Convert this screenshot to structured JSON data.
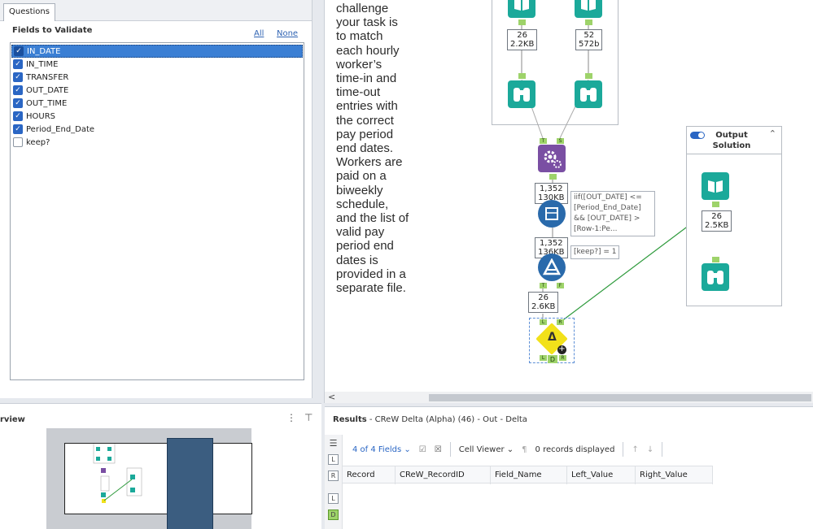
{
  "config": {
    "tab_label": "Questions",
    "fields_heading": "Fields to Validate",
    "all_link": "All",
    "none_link": "None",
    "fields": [
      {
        "label": "IN_DATE",
        "checked": true,
        "selected": true
      },
      {
        "label": "IN_TIME",
        "checked": true,
        "selected": false
      },
      {
        "label": "TRANSFER",
        "checked": true,
        "selected": false
      },
      {
        "label": "OUT_DATE",
        "checked": true,
        "selected": false
      },
      {
        "label": "OUT_TIME",
        "checked": true,
        "selected": false
      },
      {
        "label": "HOURS",
        "checked": true,
        "selected": false
      },
      {
        "label": "Period_End_Date",
        "checked": true,
        "selected": false
      },
      {
        "label": "keep?",
        "checked": false,
        "selected": false
      }
    ]
  },
  "canvas": {
    "story_text": "challenge your task is to match each hourly worker’s time-in and time-out entries with the correct pay period end dates. Workers are paid on a biweekly schedule, and the list of valid pay period end dates is provided in a separate file.",
    "badges": {
      "left_input": {
        "count": "26",
        "size": "2.2KB"
      },
      "right_input": {
        "count": "52",
        "size": "572b"
      },
      "join_out": {
        "count": "1,352",
        "size": "130KB"
      },
      "formula_out": {
        "count": "1,352",
        "size": "136KB"
      },
      "filter_out": {
        "count": "26",
        "size": "2.6KB"
      },
      "solution_out": {
        "count": "26",
        "size": "2.5KB"
      }
    },
    "formula_annotation": "iif([OUT_DATE] <= [Period_End_Date] && [OUT_DATE] > [Row-1:Pe...",
    "filter_annotation": "[keep?] = 1",
    "output_container_title": "Output Solution",
    "connector_labels": {
      "T": "T",
      "S": "S",
      "F": "F",
      "L": "L",
      "R": "R",
      "D": "D"
    },
    "scroll_left_arrow": "<"
  },
  "overview": {
    "title": "rview",
    "more_icon": "⋮",
    "pin_icon": "⊤"
  },
  "results": {
    "title_bold": "Results",
    "title_rest": " - CReW Delta (Alpha) (46) - Out - Delta",
    "fields_dropdown": "4 of 4 Fields",
    "cell_viewer": "Cell Viewer",
    "records_displayed": "0 records displayed",
    "columns": [
      "Record",
      "CReW_RecordID",
      "Field_Name",
      "Left_Value",
      "Right_Value"
    ]
  },
  "colors": {
    "tool_teal": "#1ba99a",
    "tool_purple": "#7a4fa3",
    "tool_blue": "#2a6aab",
    "delta_yellow": "#f2e11a",
    "connector_green": "#9ed36a",
    "link_blue": "#2f63b3",
    "wire_green": "#2e9a3c"
  }
}
